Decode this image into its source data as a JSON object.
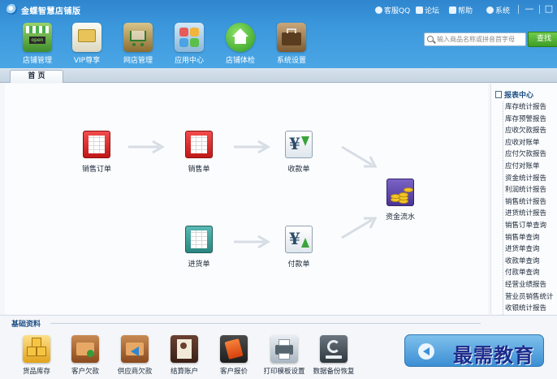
{
  "app": {
    "title": "金蝶智慧店铺版"
  },
  "titlebar": {
    "links": [
      {
        "id": "qq",
        "label": "客服QQ",
        "icon": "headset-icon"
      },
      {
        "id": "forum",
        "label": "论坛",
        "icon": "people-icon"
      },
      {
        "id": "help",
        "label": "帮助",
        "icon": "book-icon"
      },
      {
        "id": "system",
        "label": "系统",
        "icon": "gear-icon"
      }
    ],
    "window_controls": [
      "—",
      "□"
    ]
  },
  "nav": {
    "items": [
      {
        "id": "store",
        "label": "店铺管理",
        "icon": "storefront-icon",
        "badge": "open"
      },
      {
        "id": "vip",
        "label": "VIP尊享",
        "icon": "vip-card-icon"
      },
      {
        "id": "eshop",
        "label": "网店管理",
        "icon": "shopping-cart-icon"
      },
      {
        "id": "apps",
        "label": "应用中心",
        "icon": "app-grid-icon"
      },
      {
        "id": "experience",
        "label": "店铺体检",
        "icon": "home-check-icon"
      },
      {
        "id": "settings",
        "label": "系统设置",
        "icon": "toolbox-icon"
      }
    ]
  },
  "search": {
    "placeholder": "输入商品名称或拼音首字母",
    "button_label": "查找"
  },
  "tabs": [
    {
      "id": "home",
      "label": "首 页"
    }
  ],
  "workflow": {
    "items": [
      {
        "id": "sales_order",
        "label": "销售订单",
        "icon": "sales-order-icon"
      },
      {
        "id": "sales_slip",
        "label": "销售单",
        "icon": "sales-slip-icon"
      },
      {
        "id": "receipt",
        "label": "收款单",
        "icon": "receipt-yen-icon"
      },
      {
        "id": "cash_flow",
        "label": "资金流水",
        "icon": "cash-flow-icon"
      },
      {
        "id": "purchase",
        "label": "进货单",
        "icon": "purchase-slip-icon"
      },
      {
        "id": "payment",
        "label": "付款单",
        "icon": "payment-yen-icon"
      }
    ]
  },
  "reports": {
    "title": "报表中心",
    "items": [
      "库存统计报告",
      "库存预警报告",
      "应收欠款报告",
      "应收对账单",
      "应付欠款报告",
      "应付对账单",
      "资金统计报告",
      "利润统计报告",
      "销售统计报告",
      "进货统计报告",
      "销售订单查询",
      "销售单查询",
      "进货单查询",
      "收款单查询",
      "付款单查询",
      "经营业绩报告",
      "营业员销售统计",
      "收银统计报告"
    ]
  },
  "basic": {
    "title": "基础资料",
    "items": [
      {
        "id": "goods",
        "label": "货品库存",
        "icon": "boxes-icon"
      },
      {
        "id": "customer_debt",
        "label": "客户欠款",
        "icon": "folder-person-icon"
      },
      {
        "id": "supplier_debt",
        "label": "供应商欠款",
        "icon": "folder-arrow-icon"
      },
      {
        "id": "accounts",
        "label": "结算账户",
        "icon": "ledger-icon"
      },
      {
        "id": "quote",
        "label": "客户报价",
        "icon": "price-tag-icon"
      },
      {
        "id": "print",
        "label": "打印模板设置",
        "icon": "printer-icon"
      },
      {
        "id": "backup",
        "label": "数据备份恢复",
        "icon": "backup-drive-icon"
      }
    ]
  },
  "watermark": "最需教育"
}
